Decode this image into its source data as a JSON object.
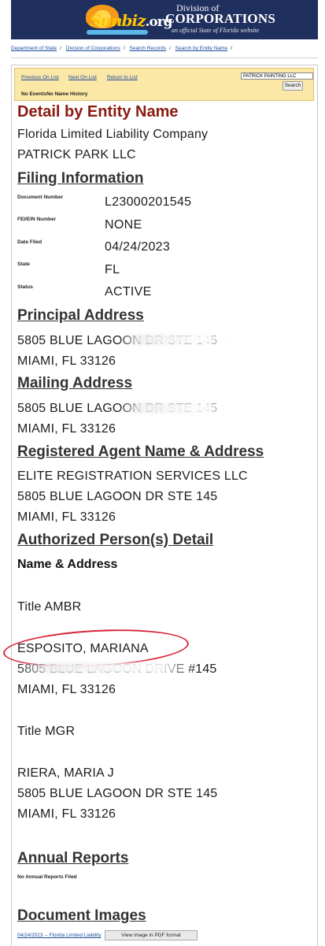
{
  "header": {
    "logo_text": "Sunbiz",
    "logo_org": ".org",
    "division_of": "Division of",
    "corporations": "Corporations",
    "tagline": "an official State of Florida website"
  },
  "breadcrumb": [
    "Department of State",
    "Division of Corporations",
    "Search Records",
    "Search by Entity Name"
  ],
  "nav": {
    "previous": "Previous On List",
    "next": "Next On List",
    "return": "Return to List",
    "no_events": "No Events",
    "no_name_history": "No Name History",
    "search_value": "PATRICK PAINTING LLC",
    "search_button": "Search"
  },
  "detail": {
    "heading": "Detail by Entity Name",
    "entity_type": "Florida Limited Liability Company",
    "entity_name": "PATRICK PARK LLC"
  },
  "filing": {
    "heading": "Filing Information",
    "rows": [
      {
        "label": "Document Number",
        "value": "L23000201545"
      },
      {
        "label": "FEI/EIN Number",
        "value": "NONE"
      },
      {
        "label": "Date Filed",
        "value": "04/24/2023"
      },
      {
        "label": "State",
        "value": "FL"
      },
      {
        "label": "Status",
        "value": "ACTIVE"
      }
    ]
  },
  "principal": {
    "heading": "Principal Address",
    "line1": "5805 BLUE LAGOON DR STE 145",
    "line2": "MIAMI, FL 33126"
  },
  "mailing": {
    "heading": "Mailing Address",
    "line1": "5805 BLUE LAGOON DR STE 145",
    "line2": "MIAMI, FL 33126"
  },
  "agent": {
    "heading": "Registered Agent Name & Address",
    "name": "ELITE REGISTRATION SERVICES LLC",
    "line1": "5805 BLUE LAGOON DR STE 145",
    "line2": "MIAMI, FL 33126"
  },
  "authorized": {
    "heading": "Authorized Person(s) Detail",
    "subheading": "Name & Address",
    "persons": [
      {
        "title": "Title AMBR",
        "name": "ESPOSITO, MARIANA",
        "line1": "5805 BLUE LAGOON DRIVE #145",
        "line2": "MIAMI, FL 33126"
      },
      {
        "title": "Title MGR",
        "name": "RIERA, MARIA J",
        "line1": "5805 BLUE LAGOON DR STE 145",
        "line2": "MIAMI, FL 33126"
      }
    ]
  },
  "annual": {
    "heading": "Annual Reports",
    "note": "No Annual Reports Filed"
  },
  "images": {
    "heading": "Document Images",
    "link": "04/24/2023 -- Florida Limited Liability",
    "button": "View image in PDF format"
  },
  "colors": {
    "banner": "#1f2f5e",
    "heading_red": "#8b1a10",
    "nav_bg": "#fbe7a6",
    "annotation_circle": "#d6263a"
  }
}
